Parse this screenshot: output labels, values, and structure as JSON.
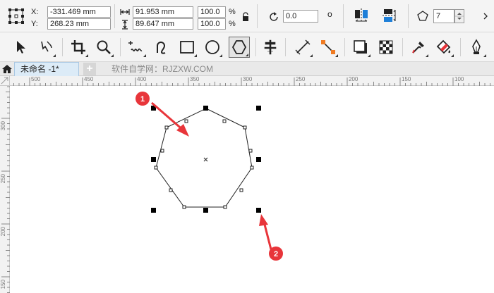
{
  "propbar": {
    "x_label": "X:",
    "y_label": "Y:",
    "x_value": "-331.469 mm",
    "y_value": "268.23 mm",
    "width_value": "91.953 mm",
    "height_value": "89.647 mm",
    "scale_w": "100.0",
    "scale_h": "100.0",
    "pct": "%",
    "rotation": "0.0",
    "degree": "o",
    "sides": "7"
  },
  "tabs": {
    "document": "未命名 -1*",
    "add": "+",
    "watermark": "软件自学网：RJZXW.COM"
  },
  "ruler": {
    "h_labels": [
      "500",
      "450",
      "400",
      "350",
      "300",
      "250",
      "200",
      "150",
      "100"
    ],
    "v_labels": [
      "300",
      "250",
      "200",
      "150"
    ],
    "unit": "mm"
  },
  "callouts": {
    "one": "1",
    "two": "2"
  },
  "colors": {
    "accent_red": "#e8353a",
    "tab_active": "#dcebf7",
    "selection": "#000000"
  }
}
